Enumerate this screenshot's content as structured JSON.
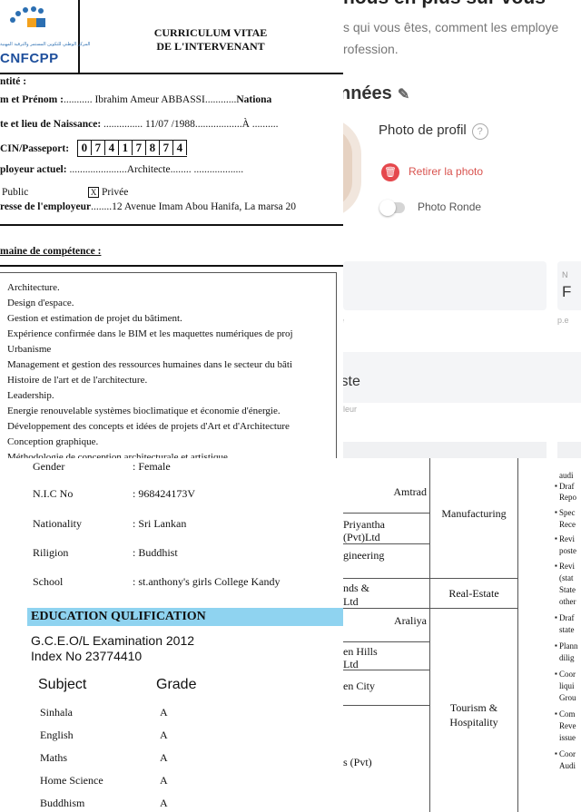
{
  "cv": {
    "logo_brand": "CNFCPP",
    "logo_arabic": "المركز الوطني للتكوين المستمر والترقية المهنية",
    "title_line1": "CURRICULUM VITAE",
    "title_line2": "DE L'INTERVENANT",
    "identity_label": "ntité :",
    "name_label": "m et Prénom :",
    "name_value": "........... Ibrahim Ameur ABBASSI............",
    "nationality_label": "Nationa",
    "birth_label": "te et lieu de Naissance:",
    "birth_value": " ............... 11/07 /1988..................À ..........",
    "cin_label": "CIN/Passeport:",
    "cin_digits": [
      "0",
      "7",
      "4",
      "1",
      "7",
      "8",
      "7",
      "4"
    ],
    "employer_label": "ployeur actuel:",
    "employer_value": " ......................Architecte........ ...................",
    "public_label": "Public",
    "private_check": "X",
    "private_label": "Privée",
    "address_label": "resse de l'employeur",
    "address_value": "........12 Avenue Imam Abou Hanifa, La marsa 20",
    "competence_label": "maine de compétence :",
    "competences": [
      "Architecture.",
      "Design d'espace.",
      "Gestion et estimation de projet du bâtiment.",
      "Expérience confirmée dans le BIM et les maquettes numériques de proj",
      "Urbanisme",
      "Management et gestion des ressources humaines dans le secteur du bâti",
      "Histoire de l'art et de l'architecture.",
      "Leadership.",
      "Energie renouvelable systèmes bioclimatique et économie d'énergie.",
      "Développement des concepts et idées de projets d'Art et d'Architecture",
      "Conception graphique.",
      "Méthodologie de conception architecturale et artistique."
    ]
  },
  "profile": {
    "heading": "nous en plus sur vous",
    "intro_line1": "s qui vous êtes, comment les employe",
    "intro_line2": "rofession.",
    "section_title": "nnées",
    "photo_label": "Photo de profil",
    "help_icon_char": "?",
    "remove_photo": "Retirer la photo",
    "round_photo": "Photo Ronde",
    "field_n": "N",
    "field_f": "F",
    "field_e": "e",
    "field_pd": "p.e",
    "field_iste": "iste",
    "field_leur": "leur"
  },
  "slcv": {
    "gender_label": "Gender",
    "gender_value": ": Female",
    "nic_label": "N.I.C No",
    "nic_value": ": 968424173V",
    "nationality_label": "Nationality",
    "nationality_value": ": Sri Lankan",
    "religion_label": "Riligion",
    "religion_value": ": Buddhist",
    "school_label": "School",
    "school_value": ": st.anthony's girls College Kandy",
    "education_title": "EDUCATION QULIFICATION",
    "exam_line1": "G.C.E.O/L Examination 2012",
    "exam_line2": "Index No 23774410",
    "subject_header": "Subject",
    "grade_header": "Grade",
    "subjects": [
      {
        "subject": "Sinhala",
        "grade": "A"
      },
      {
        "subject": "English",
        "grade": "A"
      },
      {
        "subject": "Maths",
        "grade": "A"
      },
      {
        "subject": "Home Science",
        "grade": "A"
      },
      {
        "subject": "Buddhism",
        "grade": "A"
      }
    ]
  },
  "table": {
    "companies": [
      "Amtrad",
      "Priyantha",
      "(Pvt)Ltd",
      "gineering",
      "nds &",
      "Ltd",
      "Araliya",
      "en Hills",
      "Ltd",
      "en City",
      "s (Pvt)"
    ],
    "sectors": [
      "Manufacturing",
      "Real-Estate",
      "Tourism &",
      "Hospitality"
    ]
  },
  "bullets": {
    "lines": [
      "audi",
      "Draf",
      "Repo",
      "Spec",
      "Rece",
      "Revi",
      "poste",
      "Revi",
      "(stat",
      "State",
      "other",
      "Draf",
      "state",
      "Plann",
      "dilig",
      "Coor",
      "liqui",
      "Grou",
      "Com",
      "Reve",
      "issue",
      "Coor",
      "Audi"
    ]
  }
}
